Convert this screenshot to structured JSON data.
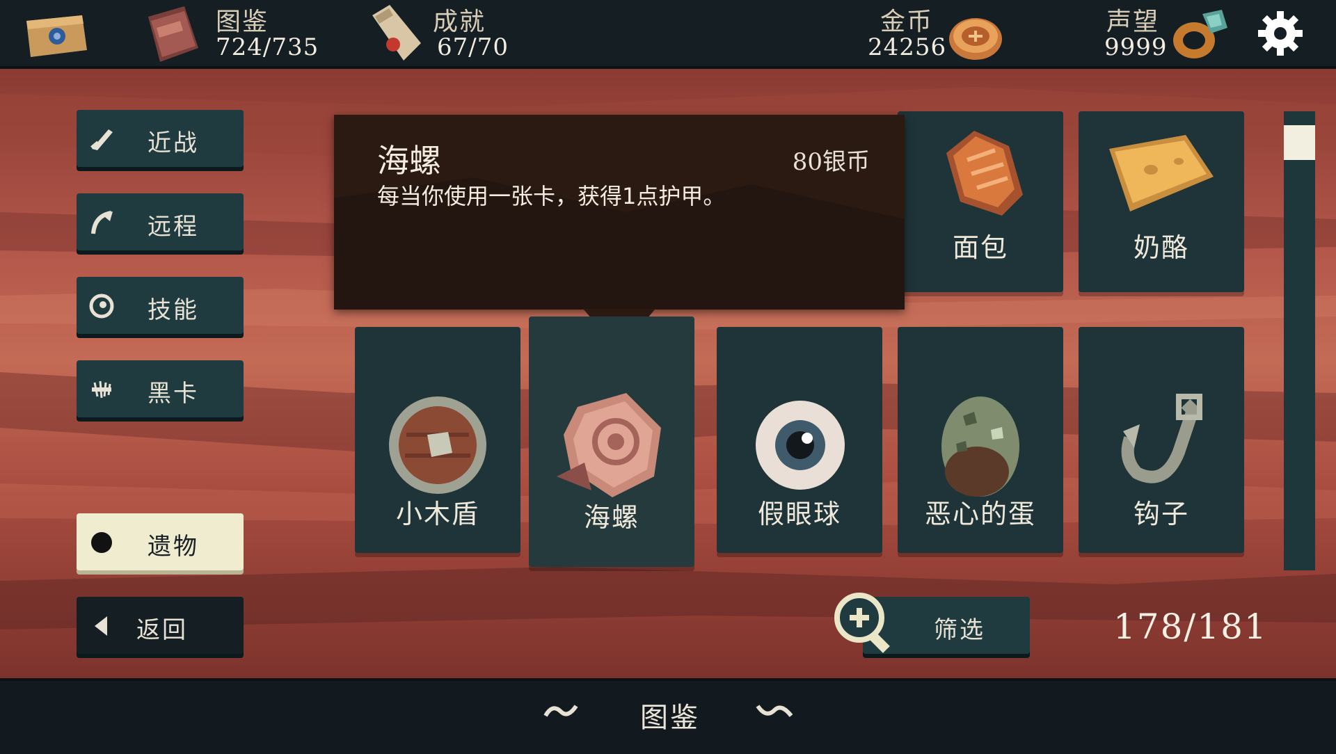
{
  "topbar": {
    "compendium": {
      "label": "图鉴",
      "value": "724/735"
    },
    "achievements": {
      "label": "成就",
      "value": "67/70"
    },
    "gold": {
      "label": "金币",
      "value": "24256"
    },
    "reputation": {
      "label": "声望",
      "value": "9999"
    }
  },
  "sidebar": {
    "items": [
      {
        "label": "近战",
        "icon": "sword-icon"
      },
      {
        "label": "远程",
        "icon": "bow-icon"
      },
      {
        "label": "技能",
        "icon": "spiral-icon"
      },
      {
        "label": "黑卡",
        "icon": "bone-icon"
      },
      {
        "label": "遗物",
        "icon": "dot-icon",
        "active": true
      }
    ],
    "back_label": "返回"
  },
  "tooltip": {
    "title": "海螺",
    "price": "80银币",
    "description": "每当你使用一张卡，获得1点护甲。"
  },
  "cards_top": [
    {
      "name": "面包",
      "icon": "bread-icon"
    },
    {
      "name": "奶酪",
      "icon": "cheese-icon"
    }
  ],
  "cards_bottom": [
    {
      "name": "小木盾",
      "icon": "wooden-shield-icon"
    },
    {
      "name": "海螺",
      "icon": "conch-icon",
      "selected": true
    },
    {
      "name": "假眼球",
      "icon": "eyeball-icon"
    },
    {
      "name": "恶心的蛋",
      "icon": "egg-icon"
    },
    {
      "name": "钩子",
      "icon": "hook-icon"
    }
  ],
  "filter_label": "筛选",
  "count": "178/181",
  "footer_title": "图鉴",
  "colors": {
    "panel": "#1f3b40",
    "active": "#f0ecd0",
    "tooltip": "#2a1a12"
  }
}
